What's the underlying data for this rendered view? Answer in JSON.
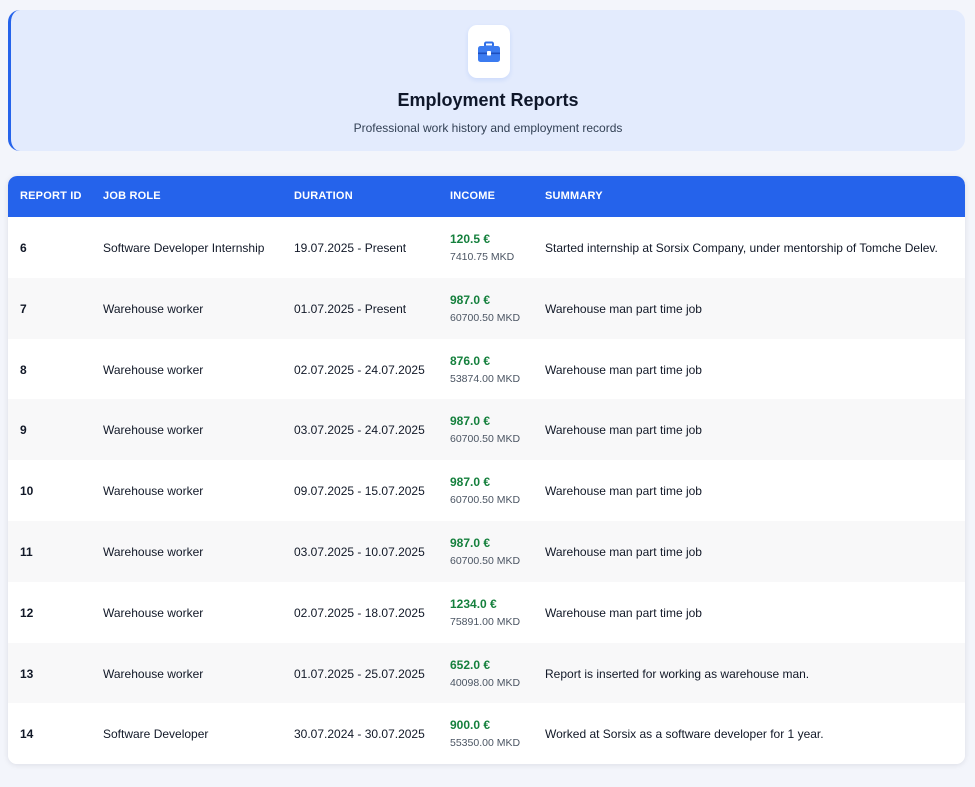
{
  "header": {
    "title": "Employment Reports",
    "subtitle": "Professional work history and employment records",
    "icon": "briefcase-icon"
  },
  "table": {
    "columns": [
      "REPORT ID",
      "JOB ROLE",
      "DURATION",
      "INCOME",
      "SUMMARY"
    ],
    "rows": [
      {
        "id": "6",
        "role": "Software Developer Internship",
        "duration": "19.07.2025 - Present",
        "income_eur": "120.5 €",
        "income_mkd": "7410.75 MKD",
        "summary": "Started internship at Sorsix Company, under mentorship of Tomche Delev."
      },
      {
        "id": "7",
        "role": "Warehouse worker",
        "duration": "01.07.2025 - Present",
        "income_eur": "987.0 €",
        "income_mkd": "60700.50 MKD",
        "summary": "Warehouse man part time job"
      },
      {
        "id": "8",
        "role": "Warehouse worker",
        "duration": "02.07.2025 - 24.07.2025",
        "income_eur": "876.0 €",
        "income_mkd": "53874.00 MKD",
        "summary": "Warehouse man part time job"
      },
      {
        "id": "9",
        "role": "Warehouse worker",
        "duration": "03.07.2025 - 24.07.2025",
        "income_eur": "987.0 €",
        "income_mkd": "60700.50 MKD",
        "summary": "Warehouse man part time job"
      },
      {
        "id": "10",
        "role": "Warehouse worker",
        "duration": "09.07.2025 - 15.07.2025",
        "income_eur": "987.0 €",
        "income_mkd": "60700.50 MKD",
        "summary": "Warehouse man part time job"
      },
      {
        "id": "11",
        "role": "Warehouse worker",
        "duration": "03.07.2025 - 10.07.2025",
        "income_eur": "987.0 €",
        "income_mkd": "60700.50 MKD",
        "summary": "Warehouse man part time job"
      },
      {
        "id": "12",
        "role": "Warehouse worker",
        "duration": "02.07.2025 - 18.07.2025",
        "income_eur": "1234.0 €",
        "income_mkd": "75891.00 MKD",
        "summary": "Warehouse man part time job"
      },
      {
        "id": "13",
        "role": "Warehouse worker",
        "duration": "01.07.2025 - 25.07.2025",
        "income_eur": "652.0 €",
        "income_mkd": "40098.00 MKD",
        "summary": "Report is inserted for working as warehouse man."
      },
      {
        "id": "14",
        "role": "Software Developer",
        "duration": "30.07.2024 - 30.07.2025",
        "income_eur": "900.0 €",
        "income_mkd": "55350.00 MKD",
        "summary": "Worked at Sorsix as a software developer for 1 year."
      }
    ]
  },
  "colors": {
    "accent": "#2563eb",
    "header_bg": "#e3ebfd",
    "income_green": "#15803d"
  }
}
